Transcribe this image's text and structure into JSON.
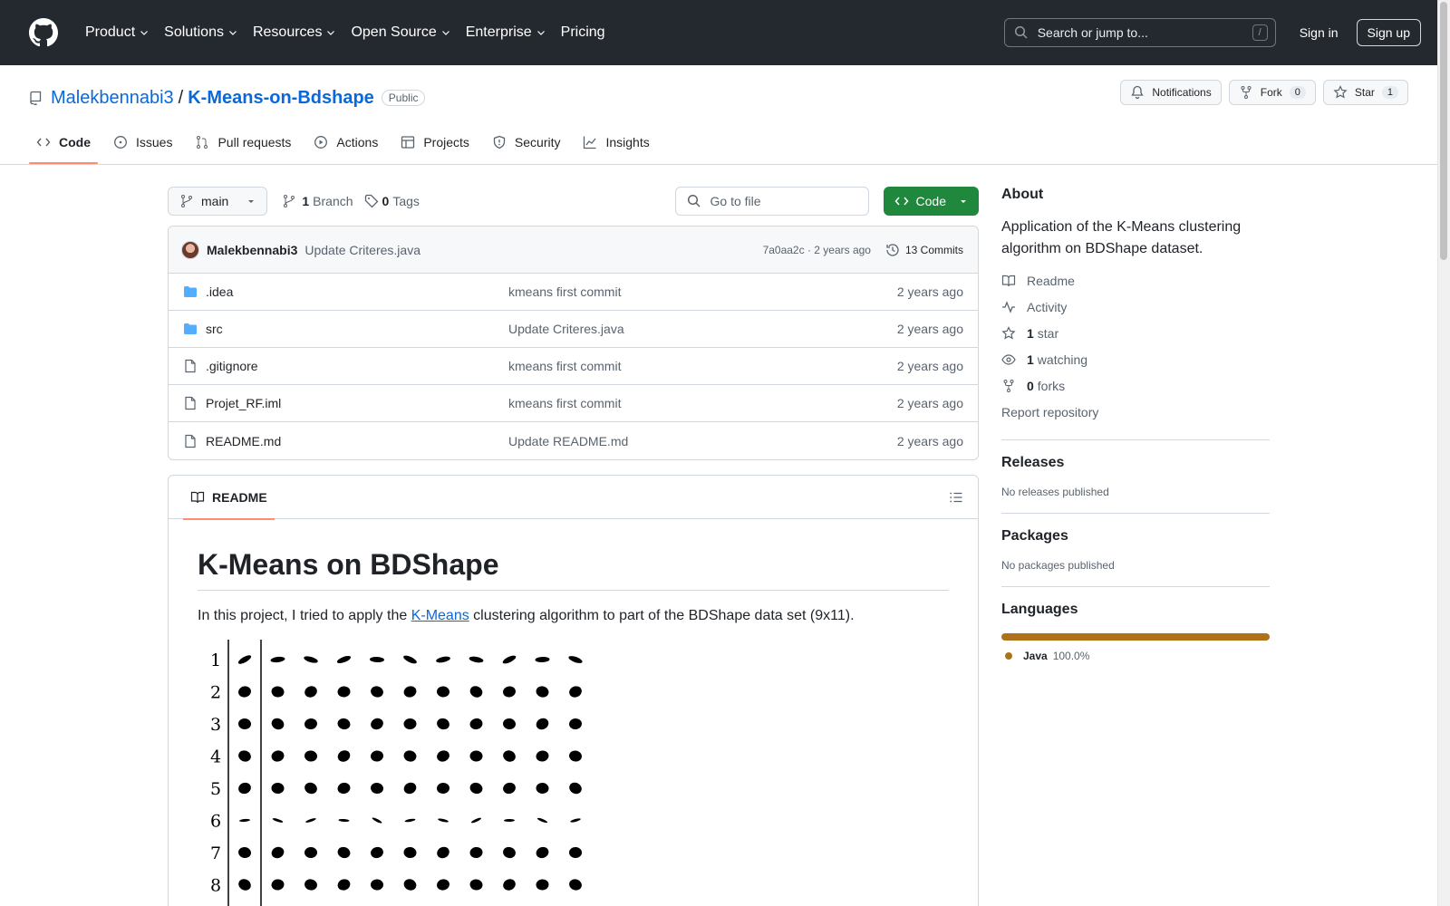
{
  "header": {
    "nav": [
      "Product",
      "Solutions",
      "Resources",
      "Open Source",
      "Enterprise",
      "Pricing"
    ],
    "search_placeholder": "Search or jump to...",
    "search_kbd": "/",
    "signin": "Sign in",
    "signup": "Sign up"
  },
  "repo": {
    "owner": "Malekbennabi3",
    "separator": "/",
    "name": "K-Means-on-Bdshape",
    "visibility": "Public",
    "notifications_label": "Notifications",
    "fork_label": "Fork",
    "fork_count": "0",
    "star_label": "Star",
    "star_count": "1"
  },
  "tabs": [
    "Code",
    "Issues",
    "Pull requests",
    "Actions",
    "Projects",
    "Security",
    "Insights"
  ],
  "toolbar": {
    "branch": "main",
    "branch_count": "1",
    "branch_label": "Branch",
    "tag_count": "0",
    "tag_label": "Tags",
    "go_to_file": "Go to file",
    "code_button": "Code"
  },
  "commit": {
    "author": "Malekbennabi3",
    "message": "Update Criteres.java",
    "hash_time": "7a0aa2c · 2 years ago",
    "commits": "13 Commits"
  },
  "files": [
    {
      "name": ".idea",
      "type": "folder",
      "message": "kmeans first commit",
      "date": "2 years ago"
    },
    {
      "name": "src",
      "type": "folder",
      "message": "Update Criteres.java",
      "date": "2 years ago"
    },
    {
      "name": ".gitignore",
      "type": "file",
      "message": "kmeans first commit",
      "date": "2 years ago"
    },
    {
      "name": "Projet_RF.iml",
      "type": "file",
      "message": "kmeans first commit",
      "date": "2 years ago"
    },
    {
      "name": "README.md",
      "type": "file",
      "message": "Update README.md",
      "date": "2 years ago"
    }
  ],
  "readme": {
    "tab_label": "README",
    "title": "K-Means on BDShape",
    "intro_before": "In this project, I tried to apply the ",
    "intro_link": "K-Means",
    "intro_after": " clustering algorithm to part of the BDShape data set (9x11).",
    "row_numbers": [
      "1",
      "2",
      "3",
      "4",
      "5",
      "6",
      "7",
      "8"
    ]
  },
  "about": {
    "title": "About",
    "description": "Application of the K-Means clustering algorithm on BDShape dataset.",
    "readme": "Readme",
    "activity": "Activity",
    "stars_count": "1",
    "stars_label": "star",
    "watching_count": "1",
    "watching_label": "watching",
    "forks_count": "0",
    "forks_label": "forks",
    "report": "Report repository"
  },
  "releases": {
    "title": "Releases",
    "sub": "No releases published"
  },
  "packages": {
    "title": "Packages",
    "sub": "No packages published"
  },
  "languages": {
    "title": "Languages",
    "name": "Java",
    "percent": "100.0%",
    "color": "#b07219"
  }
}
